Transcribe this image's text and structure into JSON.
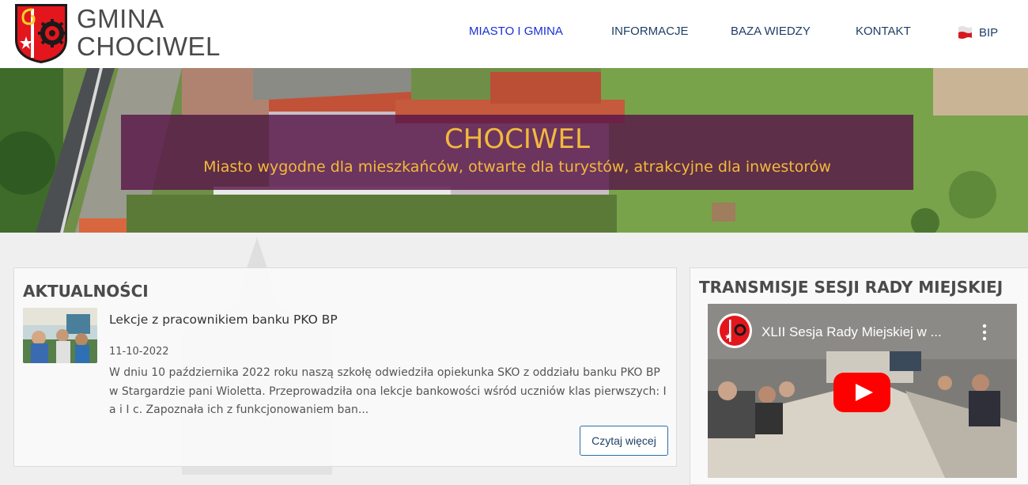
{
  "header": {
    "logo_line1": "GMINA",
    "logo_line2": "CHOCIWEL",
    "nav": [
      {
        "label": "MIASTO I GMINA",
        "active": true
      },
      {
        "label": "INFORMACJE",
        "active": false
      },
      {
        "label": "BAZA WIEDZY",
        "active": false
      },
      {
        "label": "KONTAKT",
        "active": false
      }
    ],
    "bip_label": "BIP",
    "bip_icon": "bip-flag-icon"
  },
  "hero": {
    "title": "CHOCIWEL",
    "subtitle": "Miasto wygodne dla mieszkańców, otwarte dla turystów, atrakcyjne dla inwestorów"
  },
  "news": {
    "heading": "AKTUALNOŚCI",
    "item": {
      "title": "Lekcje z pracownikiem banku PKO BP",
      "date": "11-10-2022",
      "excerpt": "W dniu 10 października 2022 roku naszą szkołę odwiedziła opiekunka SKO z oddziału banku PKO BP w Stargardzie pani Wioletta. Przeprowadziła ona lekcje bankowości wśród uczniów klas pierwszych: I a i I c. Zapoznała ich z funkcjonowaniem ban...",
      "read_more": "Czytaj więcej"
    }
  },
  "sessions": {
    "heading": "TRANSMISJE SESJI RADY MIEJSKIEJ",
    "video_title": "XLII Sesja Rady Miejskiej w ..."
  },
  "colors": {
    "hero_overlay": "#581648",
    "hero_text": "#f3b93b",
    "nav_active": "#1a2fd6",
    "nav": "#1e3f66",
    "youtube_red": "#ff0000"
  }
}
